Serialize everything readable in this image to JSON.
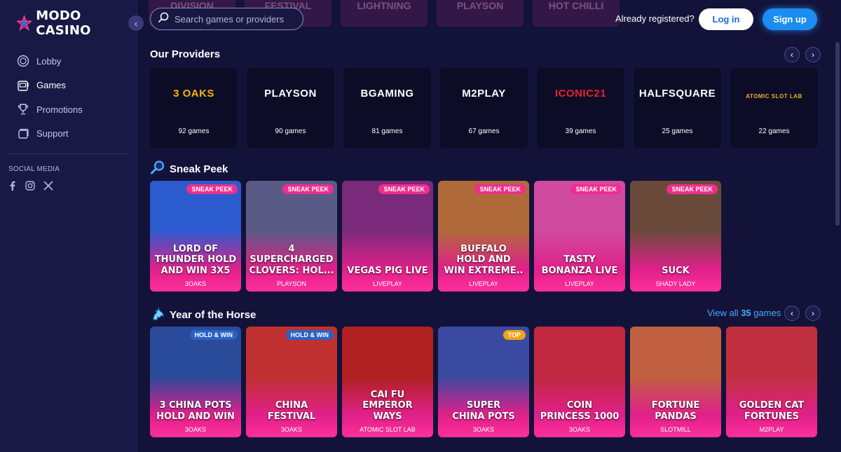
{
  "brand": {
    "name": "MODO CASINO"
  },
  "nav": {
    "items": [
      {
        "label": "Lobby",
        "icon": "chip-icon",
        "active": false
      },
      {
        "label": "Games",
        "icon": "slot-machine-icon",
        "active": true
      },
      {
        "label": "Promotions",
        "icon": "trophy-icon",
        "active": false
      },
      {
        "label": "Support",
        "icon": "support-icon",
        "active": false
      }
    ],
    "social_title": "SOCIAL MEDIA"
  },
  "header": {
    "ghost_tiles": [
      "DIVISION",
      "FESTIVAL",
      "LIGHTNING",
      "PLAYSON",
      "HOT CHILLI"
    ],
    "search_placeholder": "Search games or providers",
    "already_registered": "Already registered?",
    "login_label": "Log in",
    "signup_label": "Sign up"
  },
  "providers_section": {
    "title": "Our Providers",
    "items": [
      {
        "name": "3 OAKS",
        "count": "92 games",
        "color": "#f5b400"
      },
      {
        "name": "PLAYSON",
        "count": "90 games",
        "color": "#ffffff"
      },
      {
        "name": "BGAMING",
        "count": "81 games",
        "color": "#ffffff"
      },
      {
        "name": "M2PLAY",
        "count": "67 games",
        "color": "#ffffff"
      },
      {
        "name": "ICONIC21",
        "count": "39 games",
        "color": "#e8202e"
      },
      {
        "name": "HALFSQUARE",
        "count": "25 games",
        "color": "#ffffff"
      },
      {
        "name": "ATOMIC SLOT LAB",
        "count": "22 games",
        "color": "#f0b020"
      }
    ]
  },
  "sneak_section": {
    "title": "Sneak Peek",
    "games": [
      {
        "title": "LORD OF\nTHUNDER HOLD\nAND WIN 3X5",
        "provider": "3OAKS",
        "badge": "SNEAK PEEK",
        "bg": "#2c5bd0"
      },
      {
        "title": "4\nSUPERCHARGED\nCLOVERS: HOL...",
        "provider": "PLAYSON",
        "badge": "SNEAK PEEK",
        "bg": "#5a5a86"
      },
      {
        "title": "VEGAS PIG LIVE",
        "provider": "LIVEPLAY",
        "badge": "SNEAK PEEK",
        "bg": "#7a2a7a"
      },
      {
        "title": "BUFFALO\nHOLD AND\nWIN EXTREME..",
        "provider": "LIVEPLAY",
        "badge": "SNEAK PEEK",
        "bg": "#b06a3a"
      },
      {
        "title": "TASTY\nBONANZA LIVE",
        "provider": "LIVEPLAY",
        "badge": "SNEAK PEEK",
        "bg": "#d04aa0"
      },
      {
        "title": "SUCK",
        "provider": "SHADY LADY",
        "badge": "SNEAK PEEK",
        "bg": "#6a4a3a"
      }
    ]
  },
  "horse_section": {
    "title": "Year of the Horse",
    "view_all_prefix": "View all",
    "view_all_count": "35",
    "view_all_suffix": "games",
    "games": [
      {
        "title": "3 CHINA POTS\nHOLD AND WIN",
        "provider": "3OAKS",
        "badge": "HOLD & WIN",
        "badge_type": "hold",
        "bg": "#2a4a9a"
      },
      {
        "title": "CHINA\nFESTIVAL",
        "provider": "3OAKS",
        "badge": "HOLD & WIN",
        "badge_type": "hold",
        "bg": "#c03030"
      },
      {
        "title": "CAI FU\nEMPEROR\nWAYS",
        "provider": "ATOMIC SLOT LAB",
        "badge": "",
        "badge_type": "",
        "bg": "#b02020"
      },
      {
        "title": "SUPER\nCHINA POTS",
        "provider": "3OAKS",
        "badge": "TOP",
        "badge_type": "top",
        "bg": "#3a4aa0"
      },
      {
        "title": "COIN\nPRINCESS 1000",
        "provider": "3OAKS",
        "badge": "",
        "badge_type": "",
        "bg": "#c02840"
      },
      {
        "title": "FORTUNE\nPANDAS",
        "provider": "SLOTMILL",
        "badge": "",
        "badge_type": "",
        "bg": "#c06040"
      },
      {
        "title": "GOLDEN CAT\nFORTUNES",
        "provider": "M2PLAY",
        "badge": "",
        "badge_type": "",
        "bg": "#c03040"
      }
    ]
  }
}
